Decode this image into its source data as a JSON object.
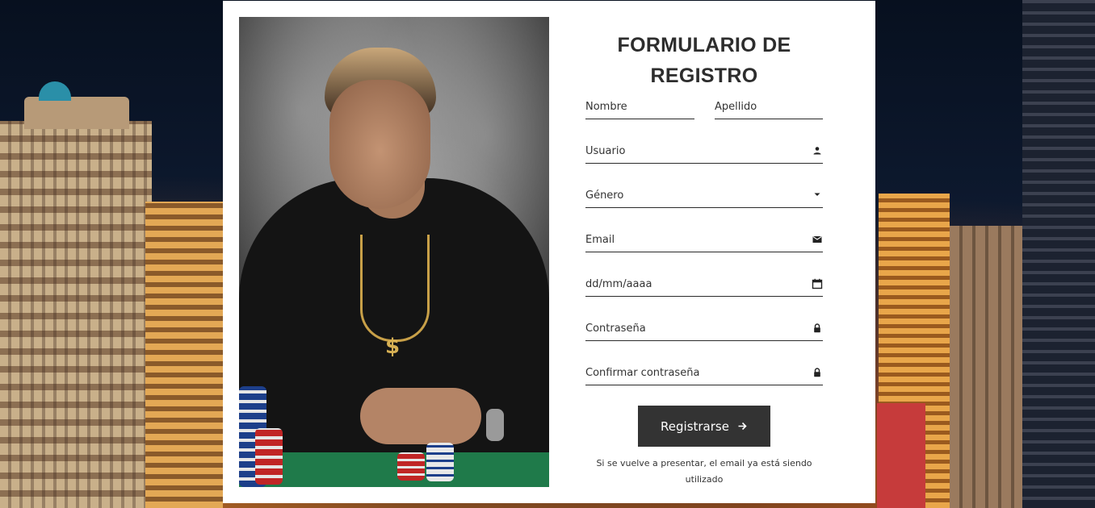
{
  "form": {
    "title": "FORMULARIO DE REGISTRO",
    "fields": {
      "nombre": "Nombre",
      "apellido": "Apellido",
      "usuario": "Usuario",
      "genero": "Género",
      "email": "Email",
      "fecha": "dd/mm/aaaa",
      "contrasena": "Contraseña",
      "confirmar": "Confirmar contraseña"
    },
    "submit_label": "Registrarse",
    "note": "Si se vuelve a presentar, el email ya está siendo utilizado"
  },
  "icons": {
    "usuario": "user-icon",
    "genero": "dropdown-caret-icon",
    "email": "envelope-icon",
    "fecha": "calendar-icon",
    "contrasena": "lock-icon",
    "confirmar": "lock-icon",
    "submit": "arrow-right-icon"
  },
  "colors": {
    "card_bg": "#ffffff",
    "text": "#2d2d2d",
    "button_bg": "#333333",
    "button_text": "#ffffff"
  }
}
